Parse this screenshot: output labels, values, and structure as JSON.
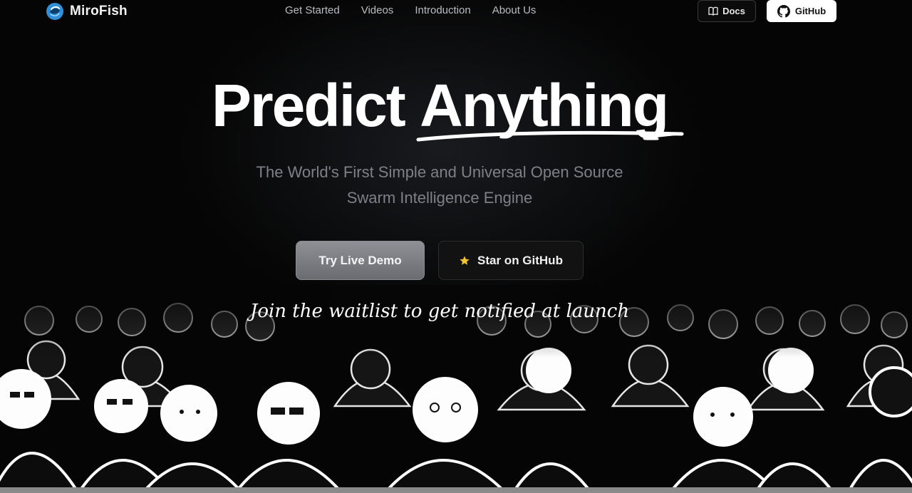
{
  "header": {
    "brand": "MiroFish",
    "nav": [
      "Get Started",
      "Videos",
      "Introduction",
      "About Us"
    ],
    "docs_label": "Docs",
    "github_label": "GitHub"
  },
  "hero": {
    "title_part1": "Predict",
    "title_part2": "Anything",
    "subtitle_line1": "The World's First Simple and Universal Open Source",
    "subtitle_line2": "Swarm Intelligence Engine",
    "demo_label": "Try Live Demo",
    "star_label": "Star on GitHub",
    "waitlist_text": "Join the waitlist to get notified at launch"
  },
  "colors": {
    "background": "#050505",
    "accent_logo": "#2f8fd8",
    "star": "#f5c431",
    "subtitle": "#7d8089"
  },
  "icons": [
    "fish-logo-icon",
    "book-icon",
    "github-icon",
    "star-icon",
    "underline-scribble"
  ]
}
